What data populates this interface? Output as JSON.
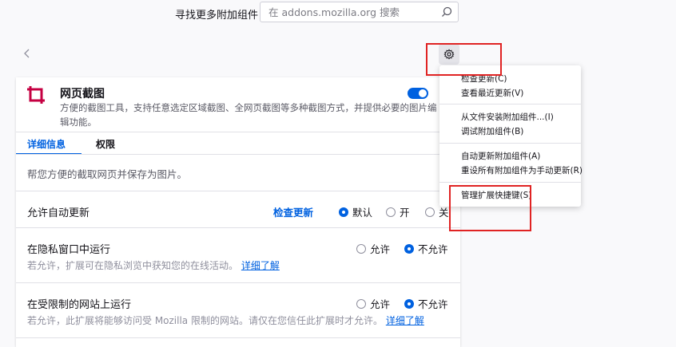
{
  "header": {
    "find_label": "寻找更多附加组件",
    "search_placeholder": "在 addons.mozilla.org 搜索"
  },
  "addon": {
    "name": "网页截图",
    "description": "方便的截图工具，支持任意选定区域截图、全网页截图等多种截图方式，并提供必要的图片编辑功能。",
    "enabled": true,
    "more": "·"
  },
  "tabs": [
    {
      "label": "详细信息",
      "selected": true
    },
    {
      "label": "权限",
      "selected": false
    }
  ],
  "details": {
    "text": "帮您方便的截取网页并保存为图片。"
  },
  "auto_update": {
    "title": "允许自动更新",
    "check_label": "检查更新",
    "options": [
      "默认",
      "开",
      "关"
    ],
    "selected": "默认"
  },
  "private_window": {
    "title": "在隐私窗口中运行",
    "subtitle": "若允许，扩展可在隐私浏览中获知您的在线活动。",
    "link": "详细了解",
    "options": [
      "允许",
      "不允许"
    ],
    "selected": "不允许"
  },
  "restricted_sites": {
    "title": "在受限制的网站上运行",
    "subtitle": "若允许，此扩展将能够访问受 Mozilla 限制的网站。请仅在您信任此扩展时才允许。",
    "link": "详细了解",
    "options": [
      "允许",
      "不允许"
    ],
    "selected": "不允许"
  },
  "menu": {
    "items": [
      "检查更新(C)",
      "查看最近更新(V)",
      "从文件安装附加组件...(I)",
      "调试附加组件(B)",
      "自动更新附加组件(A)",
      "重设所有附加组件为手动更新(R)",
      "管理扩展快捷键(S)"
    ]
  },
  "colors": {
    "accent": "#0061e0",
    "highlight": "#e02323",
    "icon": "#c50042"
  }
}
